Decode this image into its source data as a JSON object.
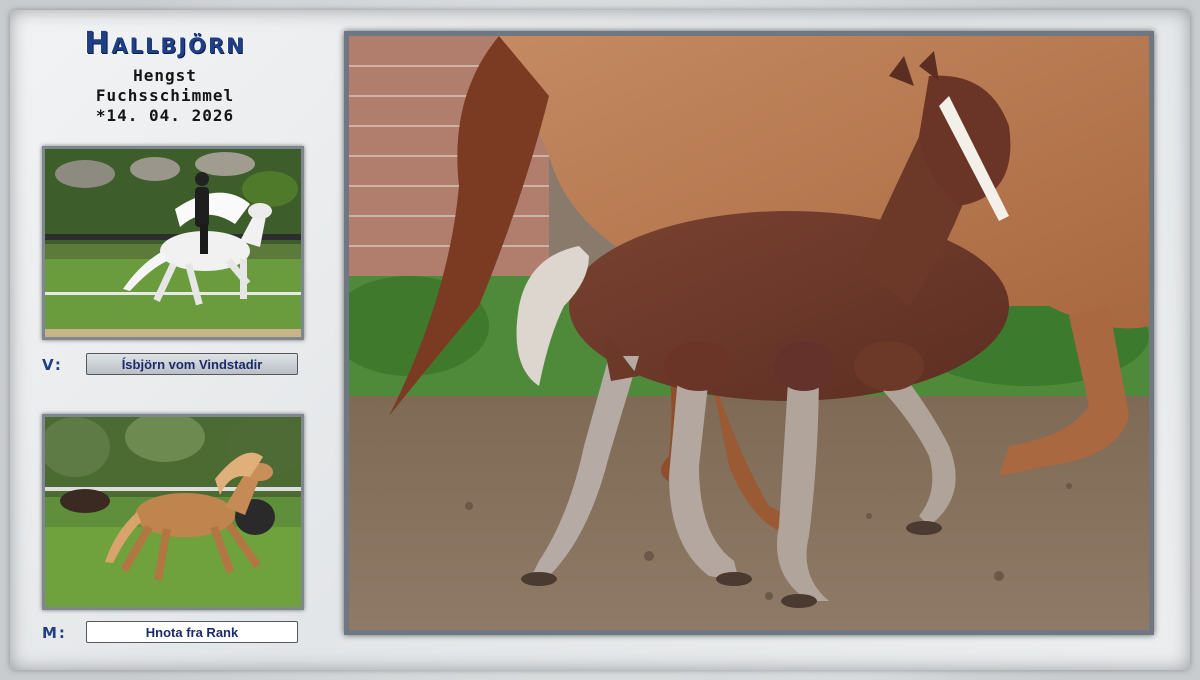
{
  "horse": {
    "name": "Hallbjörn",
    "sex": "Hengst",
    "color": "Fuchsschimmel",
    "birth": "*14. 04. 2026"
  },
  "sire": {
    "tag": "V:",
    "name": "Ísbjörn vom Vindstadir"
  },
  "dam": {
    "tag": "M:",
    "name": "Hnota fra Rank"
  },
  "colors": {
    "accent": "#1f3f86",
    "frame": "#6e7782"
  }
}
